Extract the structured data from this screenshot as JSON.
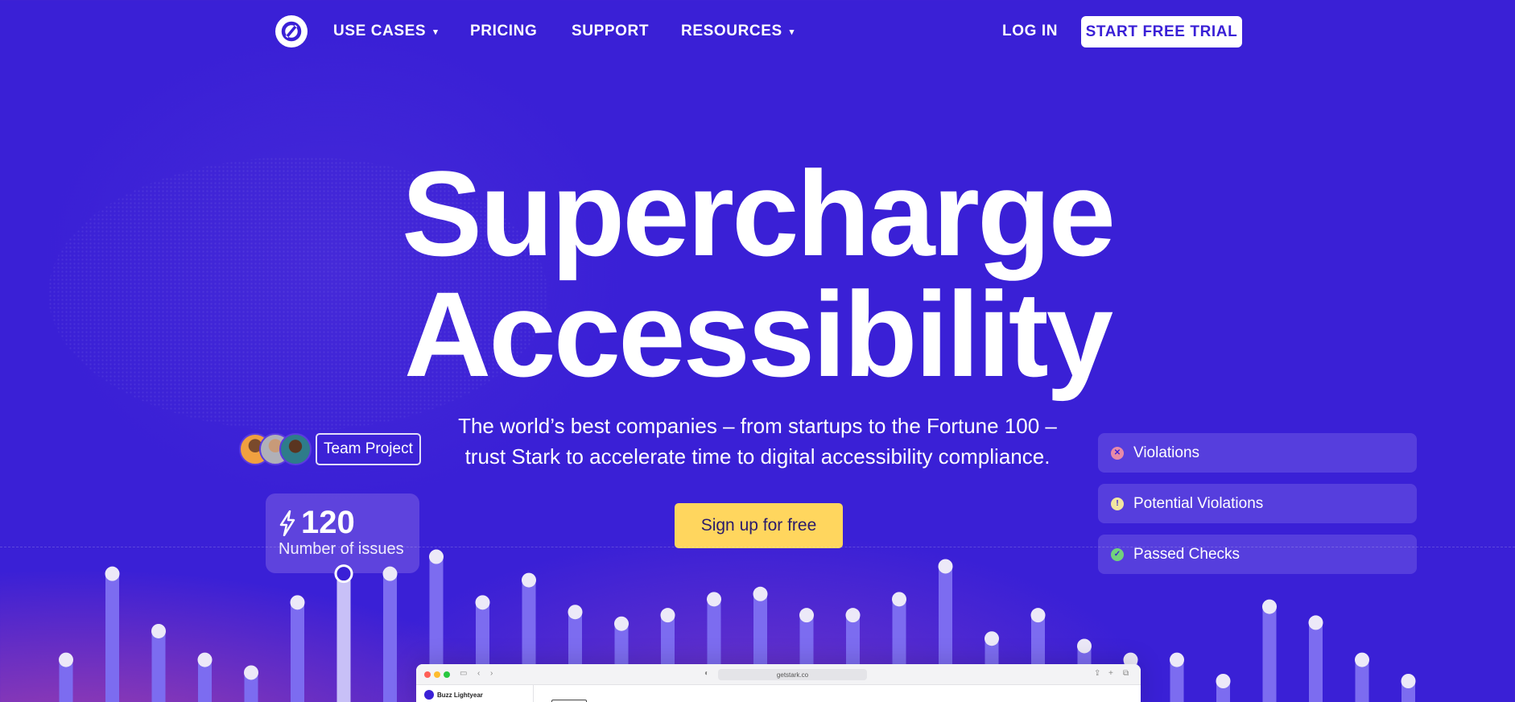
{
  "nav": {
    "items": [
      {
        "label": "USE CASES",
        "dropdown": true
      },
      {
        "label": "PRICING",
        "dropdown": false
      },
      {
        "label": "SUPPORT",
        "dropdown": false
      },
      {
        "label": "RESOURCES",
        "dropdown": true
      }
    ],
    "login": "LOG IN",
    "trial": "START FREE TRIAL",
    "caret": "▾"
  },
  "hero": {
    "line1": "Supercharge",
    "line2": "Accessibility",
    "subtitle": "The world’s best companies – from startups to the Fortune 100 – trust Stark to accelerate time to digital accessibility compliance.",
    "cta": "Sign up for free"
  },
  "team": {
    "badge": "Team Project"
  },
  "issues": {
    "count": "120",
    "label": "Number of issues",
    "icon": "lightning-bolt-icon"
  },
  "legend": [
    {
      "label": "Violations",
      "color": "#e88aa8",
      "symbol": "✕",
      "icon": "x-circle-icon"
    },
    {
      "label": "Potential Violations",
      "color": "#f2e6a0",
      "symbol": "!",
      "icon": "alert-circle-icon"
    },
    {
      "label": "Passed Checks",
      "color": "#72d27c",
      "symbol": "✓",
      "icon": "check-circle-icon"
    }
  ],
  "colors": {
    "background": "#3a20d6",
    "accent": "#ffd65e",
    "bar": "#7c6cf0",
    "bar_selected": "#c8c0f7"
  },
  "chart_data": {
    "type": "bar",
    "selected_index": 6,
    "values": [
      20,
      101,
      47,
      20,
      8,
      74,
      101,
      101,
      117,
      74,
      95,
      65,
      54,
      62,
      77,
      82,
      62,
      62,
      77,
      108,
      40,
      62,
      33,
      20,
      20,
      0,
      70,
      55,
      20,
      0
    ]
  },
  "browser": {
    "url": "getstark.co",
    "profile": "Buzz Lightyear"
  }
}
